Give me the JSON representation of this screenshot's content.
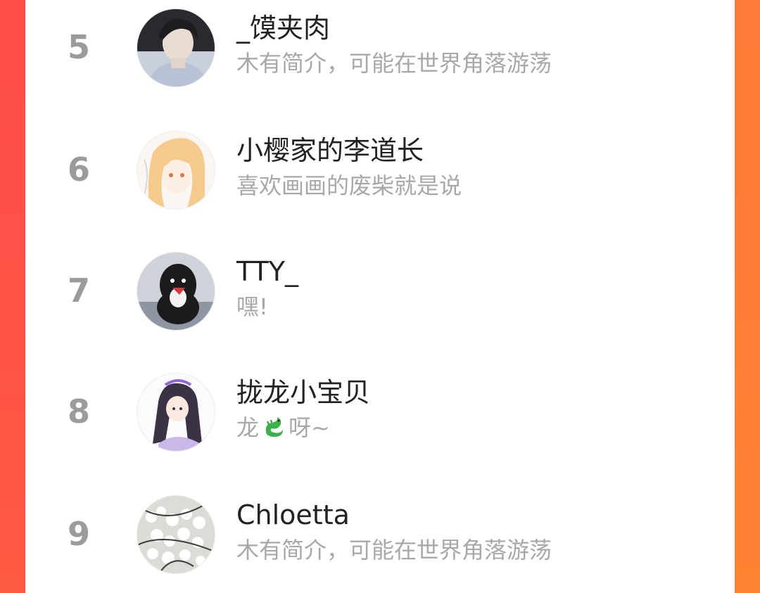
{
  "ranking": {
    "items": [
      {
        "rank": "5",
        "name": "_馍夹肉",
        "bio": "木有简介，可能在世界角落游荡"
      },
      {
        "rank": "6",
        "name": "小樱家的李道长",
        "bio": "喜欢画画的废柴就是说"
      },
      {
        "rank": "7",
        "name": "TTY_",
        "bio": "嘿!"
      },
      {
        "rank": "8",
        "name": "拢龙小宝贝",
        "bio_prefix": "龙",
        "bio_icon": "dragon-emoji-icon",
        "bio_suffix": "呀~"
      },
      {
        "rank": "9",
        "name": "Chloetta",
        "bio": "木有简介，可能在世界角落游荡"
      }
    ]
  },
  "theme": {
    "frame_left": "#ff4d4a",
    "frame_right": "#ff7f36",
    "rank_color": "#9b9b9b",
    "name_color": "#222222",
    "bio_color": "#a8a8a8"
  }
}
